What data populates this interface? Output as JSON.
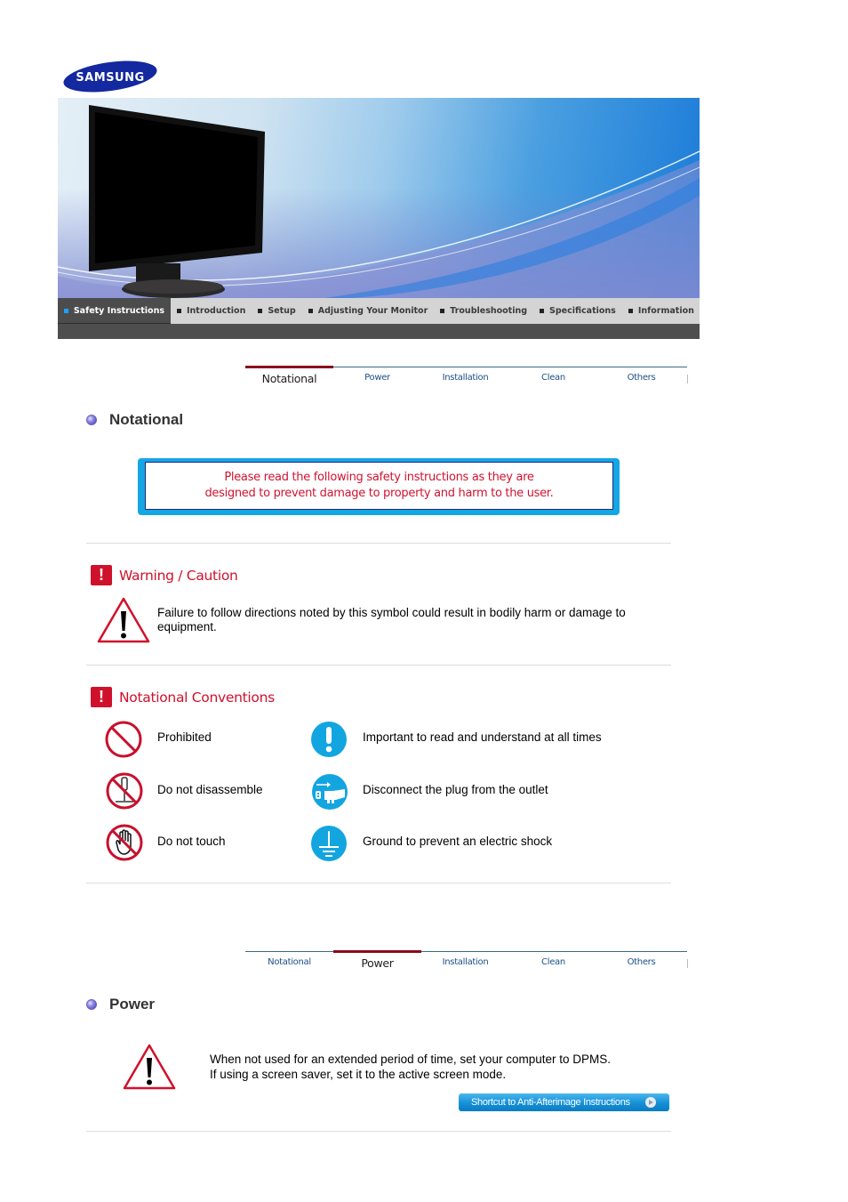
{
  "brand": {
    "logo_text": "SAMSUNG",
    "colors": {
      "brand_blue": "#1428a0",
      "accent_red": "#d0112b",
      "notice_blue": "#15a6e4",
      "tab_active": "#8b0a1e"
    }
  },
  "nav": {
    "items": [
      {
        "label": "Safety Instructions",
        "active": true
      },
      {
        "label": "Introduction"
      },
      {
        "label": "Setup"
      },
      {
        "label": "Adjusting Your Monitor"
      },
      {
        "label": "Troubleshooting"
      },
      {
        "label": "Specifications"
      },
      {
        "label": "Information"
      }
    ]
  },
  "tabs": [
    "Notational",
    "Power",
    "Installation",
    "Clean",
    "Others"
  ],
  "notational": {
    "title": "Notational",
    "active_tab": "Notational",
    "notice_line1": "Please read the following safety instructions as they are",
    "notice_line2": "designed to prevent damage to property and harm to the user.",
    "warning_heading": "Warning / Caution",
    "warning_text": "Failure to follow directions noted by this symbol could result in bodily harm or damage to equipment.",
    "conventions_heading": "Notational Conventions",
    "conventions": [
      {
        "icon": "prohibited-icon",
        "label": "Prohibited"
      },
      {
        "icon": "do-not-disassemble-icon",
        "label": "Do not disassemble"
      },
      {
        "icon": "do-not-touch-icon",
        "label": "Do not touch"
      },
      {
        "icon": "important-icon",
        "label": "Important to read and understand at all times"
      },
      {
        "icon": "unplug-icon",
        "label": "Disconnect the plug from the outlet"
      },
      {
        "icon": "ground-icon",
        "label": "Ground to prevent an electric shock"
      }
    ]
  },
  "power": {
    "title": "Power",
    "active_tab": "Power",
    "line1": "When not used for an extended period of time, set your computer to DPMS.",
    "line2": "If using a screen saver, set it to the active screen mode.",
    "shortcut_label": "Shortcut to Anti-Afterimage Instructions"
  }
}
